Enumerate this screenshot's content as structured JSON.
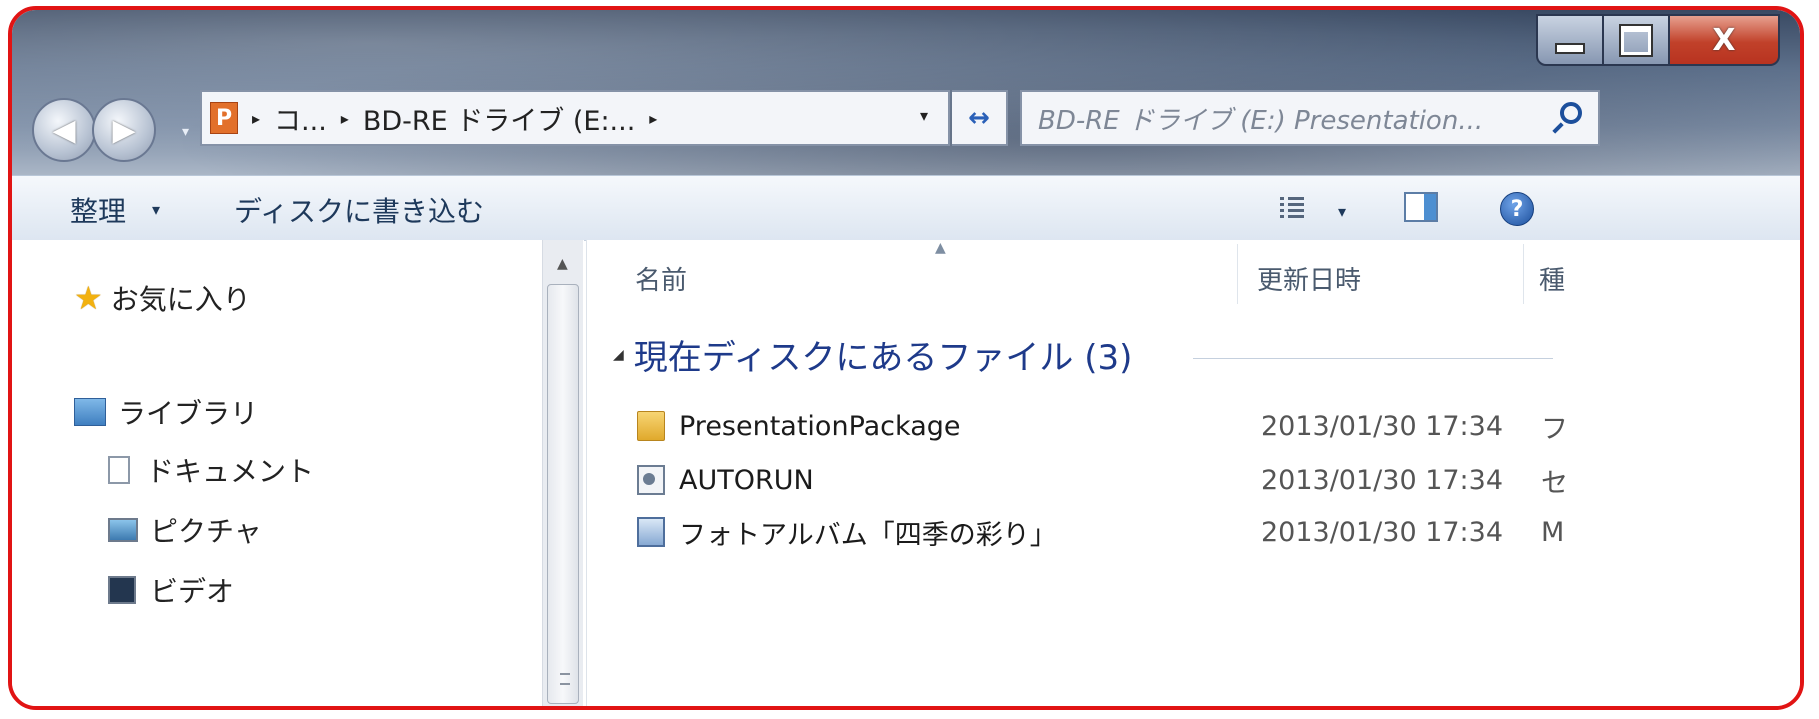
{
  "window": {
    "controls": {
      "minimize": "_",
      "maximize": "□",
      "close": "X"
    }
  },
  "nav": {
    "back_glyph": "◀",
    "forward_glyph": "▶",
    "history_glyph": "▾"
  },
  "address": {
    "app_icon_letter": "P",
    "crumbs": [
      "コ...",
      "BD-RE ドライブ (E:..."
    ],
    "separator": "▸",
    "dropdown": "▾",
    "refresh_glyph": "↔"
  },
  "search": {
    "placeholder": "BD-RE ドライブ (E:) Presentation..."
  },
  "toolbar": {
    "organize_label": "整理",
    "organize_arrow": "▾",
    "burn_label": "ディスクに書き込む",
    "view_arrow": "▾",
    "help_glyph": "?"
  },
  "navpane": {
    "favorites": "お気に入り",
    "libraries": "ライブラリ",
    "documents": "ドキュメント",
    "pictures": "ピクチャ",
    "videos": "ビデオ"
  },
  "columns": {
    "name": "名前",
    "date": "更新日時",
    "type": "種"
  },
  "group": {
    "label": "現在ディスクにあるファイル (3)"
  },
  "files": [
    {
      "name": "PresentationPackage",
      "date": "2013/01/30 17:34",
      "type": "フ",
      "icon": "folder-icon"
    },
    {
      "name": "AUTORUN",
      "date": "2013/01/30 17:34",
      "type": "セ",
      "icon": "config-file-icon"
    },
    {
      "name": "フォトアルバム「四季の彩り」",
      "date": "2013/01/30 17:34",
      "type": "M",
      "icon": "executable-icon"
    }
  ],
  "colors": {
    "frame_border": "#e11414",
    "group_text": "#1e3a8a",
    "toolbar_text": "#1e395b"
  }
}
